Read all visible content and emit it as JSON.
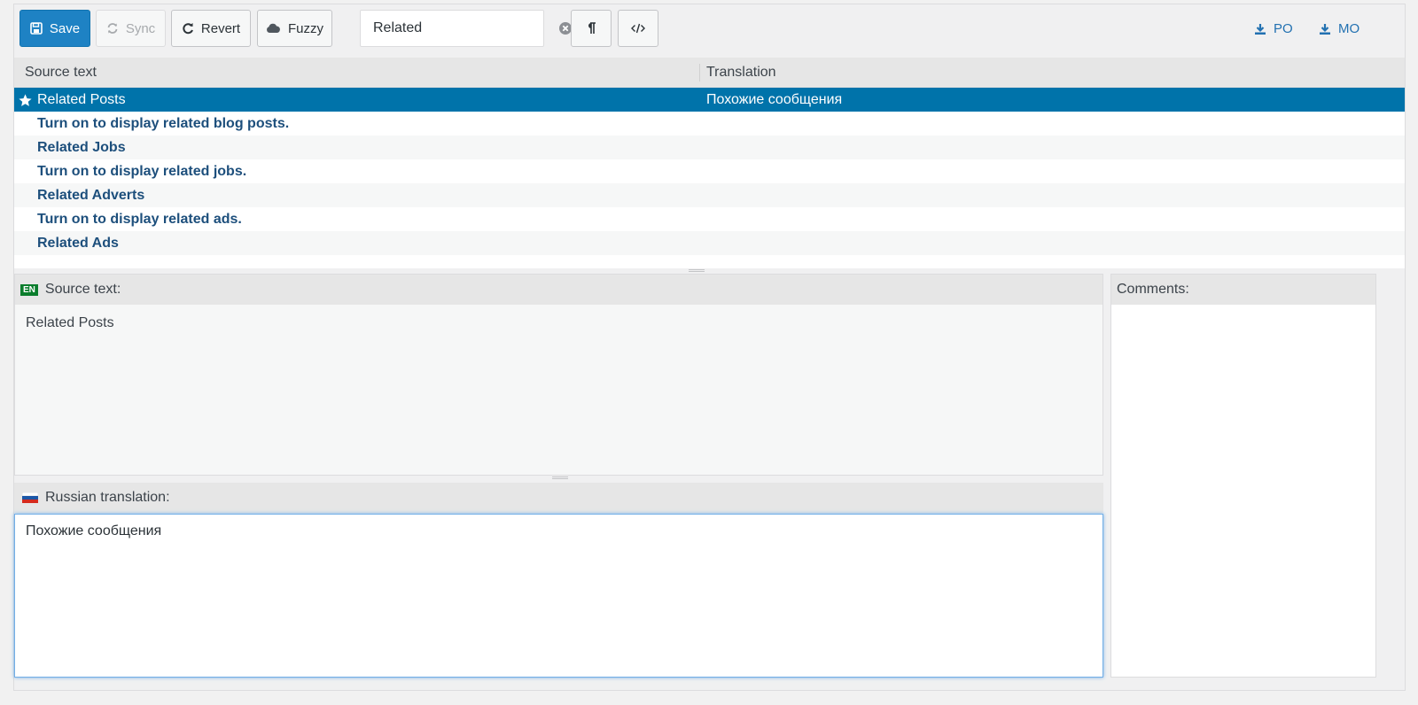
{
  "toolbar": {
    "save": "Save",
    "sync": "Sync",
    "revert": "Revert",
    "fuzzy": "Fuzzy",
    "search_value": "Related",
    "download_po": "PO",
    "download_mo": "MO"
  },
  "table": {
    "header_source": "Source text",
    "header_translation": "Translation",
    "rows": [
      {
        "source": "Related Posts",
        "translation": "Похожие сообщения"
      },
      {
        "source": "Turn on to display related blog posts.",
        "translation": ""
      },
      {
        "source": "Related Jobs",
        "translation": ""
      },
      {
        "source": "Turn on to display related jobs.",
        "translation": ""
      },
      {
        "source": "Related Adverts",
        "translation": ""
      },
      {
        "source": "Turn on to display related ads.",
        "translation": ""
      },
      {
        "source": "Related Ads",
        "translation": ""
      }
    ]
  },
  "source_pane": {
    "lang_badge": "EN",
    "title": "Source text:",
    "text": "Related Posts"
  },
  "translation_pane": {
    "title": "Russian translation:",
    "text": "Похожие сообщения"
  },
  "comments_pane": {
    "title": "Comments:"
  },
  "colors": {
    "accent": "#0073aa",
    "save_button": "#1e82c4",
    "link": "#2271b1",
    "bold_row_text": "#1d4f7c"
  },
  "icons": {
    "save": "floppy-disk-icon",
    "sync": "refresh-icon",
    "revert": "undo-icon",
    "fuzzy": "cloud-icon",
    "clear": "clear-circle-icon",
    "pilcrow": "pilcrow-icon",
    "code": "code-icon",
    "download": "download-icon",
    "star": "star-icon",
    "flag": "russian-flag-icon"
  }
}
